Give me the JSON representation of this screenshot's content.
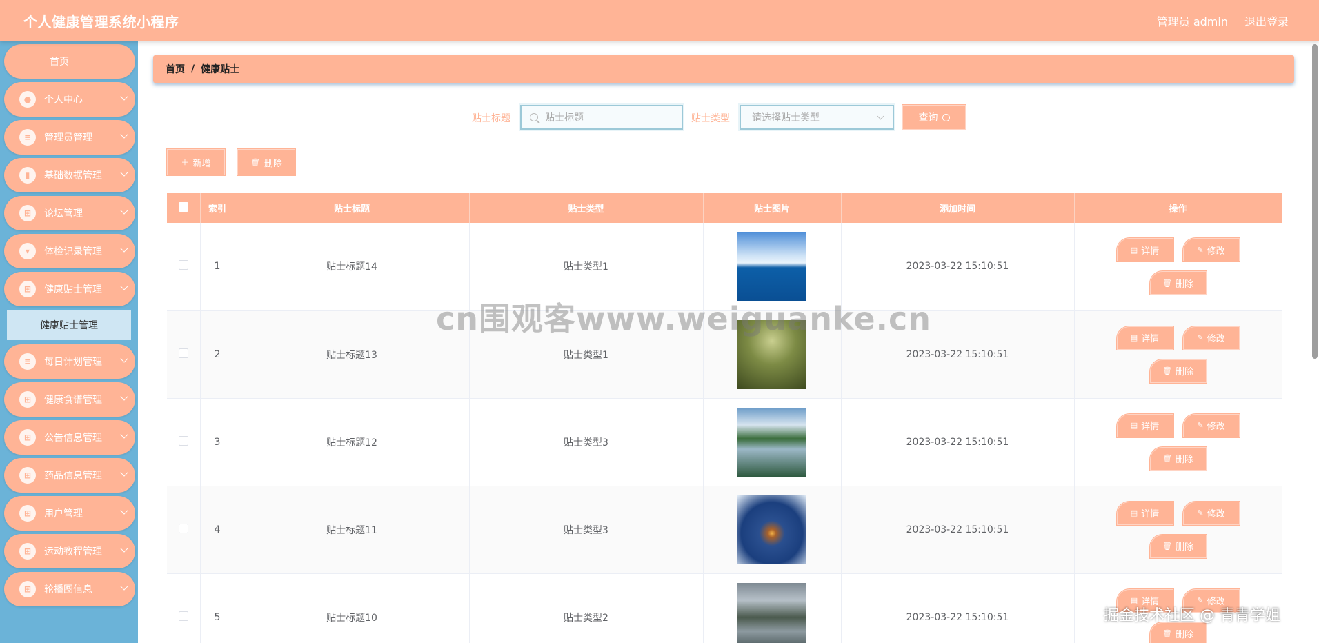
{
  "header": {
    "title": "个人健康管理系统小程序",
    "user": "管理员 admin",
    "logout": "退出登录"
  },
  "sidebar": {
    "home": "首页",
    "items": [
      {
        "label": "个人中心",
        "icon": "user-icon"
      },
      {
        "label": "管理员管理",
        "icon": "list-icon"
      },
      {
        "label": "基础数据管理",
        "icon": "chart-icon"
      },
      {
        "label": "论坛管理",
        "icon": "grid-icon"
      },
      {
        "label": "体检记录管理",
        "icon": "bookmark-icon"
      },
      {
        "label": "健康贴士管理",
        "icon": "grid-icon"
      },
      {
        "label": "每日计划管理",
        "icon": "list-icon"
      },
      {
        "label": "健康食谱管理",
        "icon": "grid-icon"
      },
      {
        "label": "公告信息管理",
        "icon": "grid-icon"
      },
      {
        "label": "药品信息管理",
        "icon": "grid-icon"
      },
      {
        "label": "用户管理",
        "icon": "grid-icon"
      },
      {
        "label": "运动教程管理",
        "icon": "grid-icon"
      },
      {
        "label": "轮播图信息",
        "icon": "grid-icon"
      }
    ],
    "submenu": "健康贴士管理"
  },
  "breadcrumb": {
    "home": "首页",
    "sep": "/",
    "current": "健康贴士"
  },
  "search": {
    "title_label": "贴士标题",
    "title_placeholder": "贴士标题",
    "type_label": "贴士类型",
    "type_placeholder": "请选择贴士类型",
    "query": "查询"
  },
  "actions": {
    "add": "新增",
    "delete": "删除"
  },
  "table": {
    "headers": [
      "索引",
      "贴士标题",
      "贴士类型",
      "贴士图片",
      "添加时间",
      "操作"
    ],
    "rows": [
      {
        "index": "1",
        "title": "贴士标题14",
        "type": "贴士类型1",
        "time": "2023-03-22 15:10:51"
      },
      {
        "index": "2",
        "title": "贴士标题13",
        "type": "贴士类型1",
        "time": "2023-03-22 15:10:51"
      },
      {
        "index": "3",
        "title": "贴士标题12",
        "type": "贴士类型3",
        "time": "2023-03-22 15:10:51"
      },
      {
        "index": "4",
        "title": "贴士标题11",
        "type": "贴士类型3",
        "time": "2023-03-22 15:10:51"
      },
      {
        "index": "5",
        "title": "贴士标题10",
        "type": "贴士类型2",
        "time": "2023-03-22 15:10:51"
      }
    ],
    "ops": {
      "detail": "详情",
      "edit": "修改",
      "delete": "删除"
    }
  },
  "watermark": "cn围观客www.weiguanke.cn",
  "credit": "掘金技术社区 @ 青青学姐",
  "colors": {
    "accent": "#ffb496",
    "sidebar": "#6bb3d8"
  }
}
